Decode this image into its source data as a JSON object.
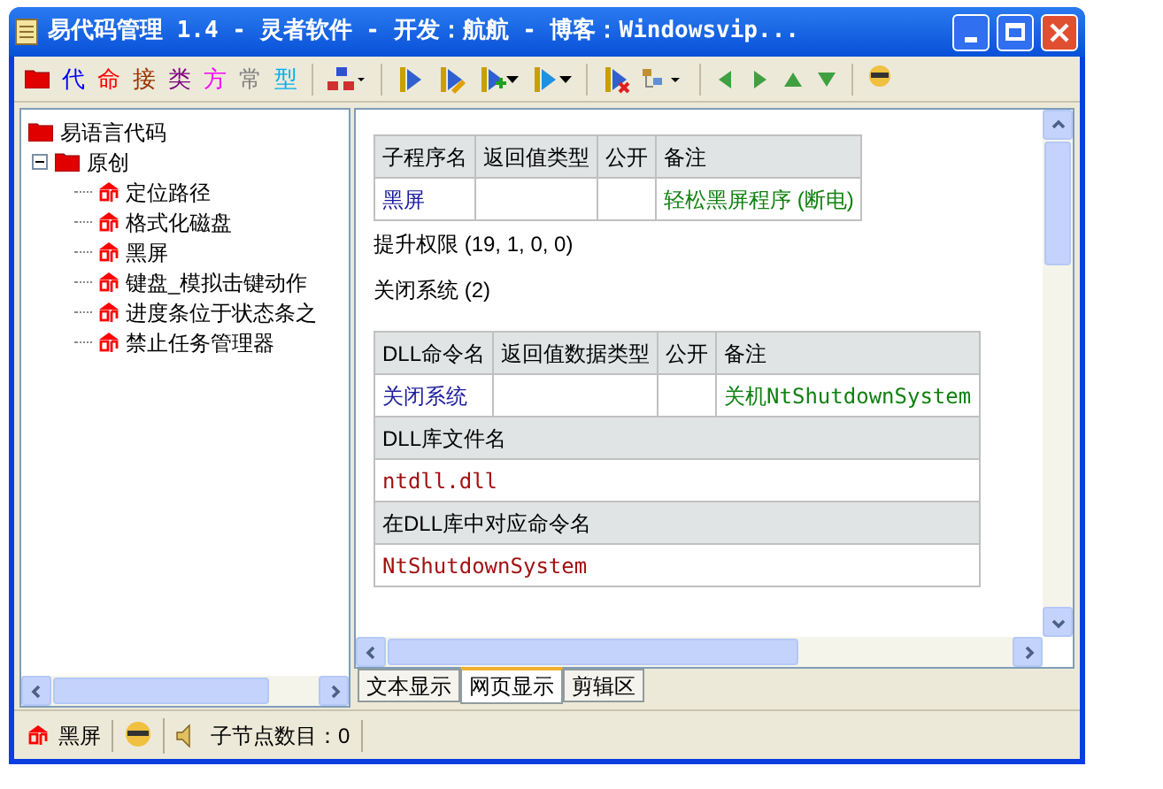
{
  "window": {
    "title": "易代码管理 1.4 - 灵者软件 - 开发：航航 - 博客：Windowsvip..."
  },
  "toolbar": {
    "chars": [
      {
        "label": "代",
        "color": "#0000ff"
      },
      {
        "label": "命",
        "color": "#ff0000"
      },
      {
        "label": "接",
        "color": "#993300"
      },
      {
        "label": "类",
        "color": "#800080"
      },
      {
        "label": "方",
        "color": "#ff00ff"
      },
      {
        "label": "常",
        "color": "#808080"
      },
      {
        "label": "型",
        "color": "#00b0f0"
      }
    ]
  },
  "tree": [
    {
      "label": "易语言代码",
      "children": [
        {
          "label": "原创",
          "expanded": true,
          "children": [
            {
              "label": "定位路径"
            },
            {
              "label": "格式化磁盘"
            },
            {
              "label": "黑屏"
            },
            {
              "label": "键盘_模拟击键动作"
            },
            {
              "label": "进度条位于状态条之"
            },
            {
              "label": "禁止任务管理器"
            }
          ]
        }
      ]
    }
  ],
  "sub_table": {
    "columns": [
      "子程序名",
      "返回值类型",
      "公开",
      "备注"
    ],
    "rows": [
      {
        "name": "黑屏",
        "remark": "轻松黑屏程序 (断电)"
      }
    ]
  },
  "lines": [
    "提升权限 (19, 1, 0, 0)",
    "关闭系统 (2)"
  ],
  "dll_table": {
    "columns": [
      "DLL命令名",
      "返回值数据类型",
      "公开",
      "备注"
    ],
    "row": {
      "name": "关闭系统",
      "remark": "关机NtShutdownSystem"
    },
    "sections": [
      {
        "heading": "DLL库文件名",
        "value": "ntdll.dll"
      },
      {
        "heading": "在DLL库中对应命令名",
        "value": "NtShutdownSystem"
      }
    ]
  },
  "tabs": [
    {
      "label": "文本显示",
      "selected": false
    },
    {
      "label": "网页显示",
      "selected": true
    },
    {
      "label": "剪辑区",
      "selected": false
    }
  ],
  "status_bar": {
    "item": "黑屏",
    "count": "子节点数目：0"
  }
}
